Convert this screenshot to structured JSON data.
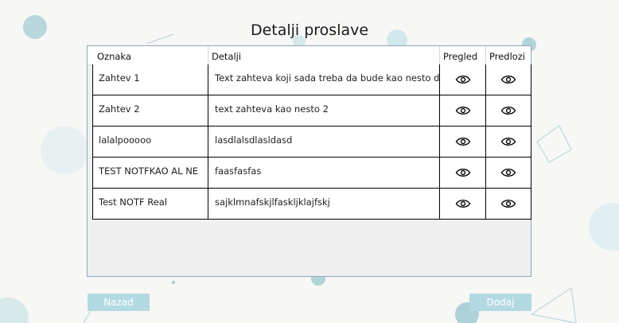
{
  "page": {
    "title": "Detalji proslave"
  },
  "table": {
    "columns": [
      "Oznaka",
      "Detalji",
      "Pregled",
      "Predlozi"
    ],
    "rows": [
      {
        "oznaka": "Zahtev 1",
        "detalji": "Text zahteva koji sada treba da bude kao nesto dugacko"
      },
      {
        "oznaka": "Zahtev 2",
        "detalji": "text zahteva kao nesto 2"
      },
      {
        "oznaka": "lalalpooooo",
        "detalji": "lasdlalsdlasldasd"
      },
      {
        "oznaka": "TEST NOTFKAO AL NE",
        "detalji": "faasfasfas"
      },
      {
        "oznaka": "Test NOTF Real",
        "detalji": "sajklmnafskjlfaskljklajfskj"
      }
    ],
    "row_icons": {
      "pregled": "eye-icon",
      "predlozi": "eye-icon"
    }
  },
  "buttons": {
    "back": "Nazad",
    "add": "Dodaj"
  },
  "colors": {
    "button_bg": "#b3d9e2",
    "button_text": "#ffffff",
    "grid_border": "#8fa6bf",
    "decor": "#9cc9cf"
  }
}
